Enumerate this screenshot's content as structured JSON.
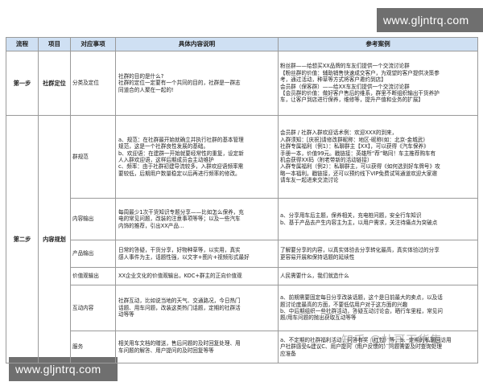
{
  "watermarks": {
    "top": "www.gljntrq.com",
    "bottom": "www.gljntrq.com",
    "zhihu": "知乎 @杜哥干货集"
  },
  "table": {
    "headers": [
      "流程",
      "项目",
      "对应事项",
      "具体内容说明",
      "参考案例"
    ],
    "step1": {
      "stage": "第一步",
      "item": "社群定位",
      "matter": "分类及定位",
      "desc": [
        "社群的目的是什么?",
        "社群的定位一定要有一个共同的目的，社群是一群志",
        "同道合的人聚在一起的!"
      ],
      "case": [
        "粉丝群——给想买XX品牌的车友们提供一个交流讨论群",
        "【粉丝群的价值：辅助销售快速成交客户，为观望的客户提供决策参",
        "考，通过活动，种草等方式将客户邀约到店】",
        "会员群（保客群）——给XX车友们提供一个交流讨论群",
        "【会员群的价值：做好客户售后的维系，群里不断组织输出干货养护",
        "车，让客户到店进行保养，维修等，提升产值和业务的扩展】"
      ]
    },
    "step2": {
      "stage": "第二步",
      "item": "内容规划",
      "rows": [
        {
          "matter": "群规范",
          "desc": [
            "a、规范：在社群最开始就确立并执行社群的基本管理",
            "规范，这是一个社群良性发展的基础。",
            "b、欢迎语：在建群一开始就要经常性的重复，设定新",
            "人入群欢迎语，这样后期成员会主动维护",
            "c、频率：由于社群初建导流较多，入群欢迎语频率需",
            "要较低，后期用户数量稳定以后再进行频率的修改。"
          ],
          "case": [
            "会员群 / 社群入群欢迎话术例：欢迎XXX的到来，",
            "入群须知：[庆祝]请修改群昵称：地区-昵称(如：北京-金城武)",
            "社群专属福利（例1）：私聊群主【XX】，可以获得《汽车保养》",
            "手册一本，价值99元。戳链接：英雄所“荐”略同！车主推荐购车有",
            "机会获得XX码（附老带新的活动链接）",
            "入群专属福利（例2）：私聊群主，可以获得《如何选到好车牌号》攻",
            "略一本福利。戳链接，还可以预约线下VIP免费试驾通道欢迎大家邀",
            "请车友一起进来交流讨论"
          ]
        },
        {
          "matter": "内容输出",
          "desc": [
            "每周最少1次干货知识专题分享——比如怎么保养，充",
            "电的常见问题，改装的注意事项等等；以及一些汽车",
            "内饰的推荐，引出XX产品…"
          ],
          "case": [
            "a、分享用车后主题，保养相关，充电桩问题，安全行车知识",
            "b、基于产品去产生内容主为主，以用户需求，关注待痛点为突破点"
          ]
        },
        {
          "matter": "产品输出",
          "desc": [
            "日常的答疑，干货分享，好物种草等，以实用，真实",
            "感人事件为主，话题性强，以文字+图片+视频形式最好"
          ],
          "case": [
            "了解要分享的内容，以真实体验去分享转化最高，真实体验过的分享",
            "更容易开展和保持话题的延续性"
          ]
        },
        {
          "matter": "价值观输出",
          "desc": [
            "XX企业文化的价值观输出，KOC+群主的正向价值观"
          ],
          "case": [
            "人民需要什么，我们就造什么"
          ]
        },
        {
          "matter": "互动内容",
          "desc": [
            "社群互动，比如说当地的天气、交通路况，今日热门",
            "话题、用车问题，改装这类热门话题，定期的社群活",
            "动等等"
          ],
          "case": [
            "a、前期需要固定每日分享改装话题，这个是日前最大的卖点，以及话",
            "题讨论度最高的方面，不要低估用户对于这方面的兴趣",
            "b、中后期组织一些社群活动，答疑互动讨论会，晒行车里程，常见问",
            "题/用车问题的抛出获取互动等等"
          ]
        },
        {
          "matter": "服务",
          "desc": [
            "相关用车文档的赠送，售后问题的及时回复处理、用",
            "车问题的解答、用户提问的及时回复等等"
          ],
          "case": [
            "a、不定期的社群福利活动，问答有奖（红包）等，b、定期的私聊回访用",
            "户社群感受&建议C、用户提问（用户反馈的）问题需要及时查询处理",
            "应准备"
          ]
        }
      ]
    }
  }
}
